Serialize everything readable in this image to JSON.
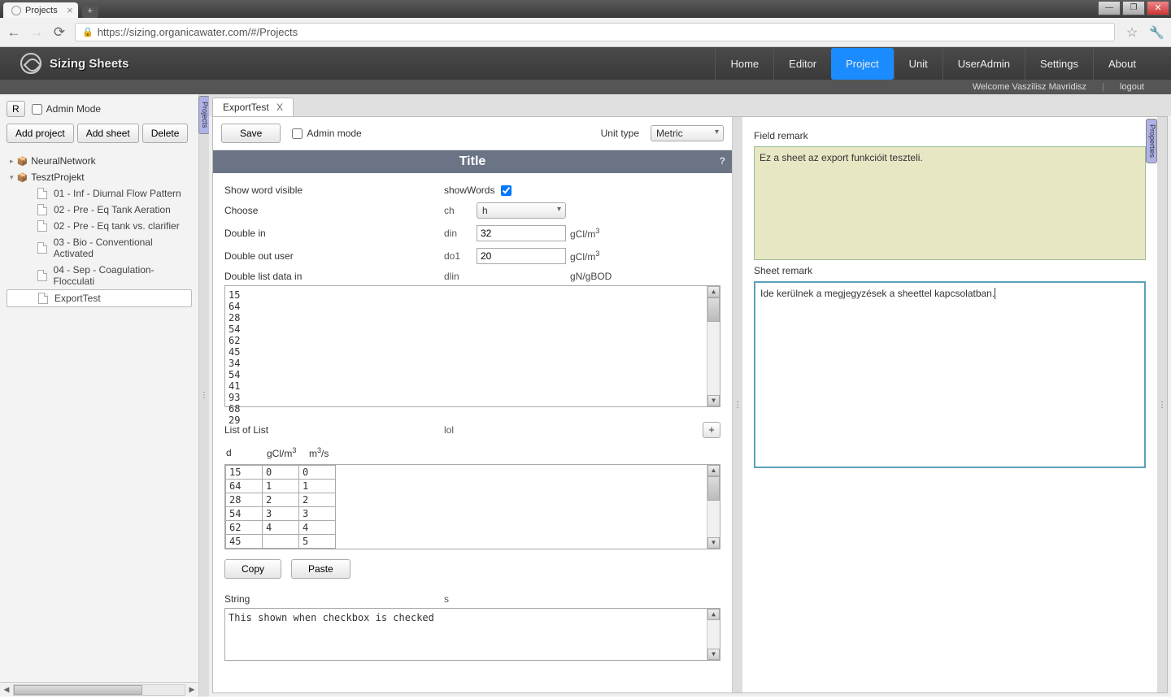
{
  "browser": {
    "tab_title": "Projects",
    "url": "https://sizing.organicawater.com/#/Projects"
  },
  "app": {
    "brand": "Sizing Sheets",
    "nav": [
      "Home",
      "Editor",
      "Project",
      "Unit",
      "UserAdmin",
      "Settings",
      "About"
    ],
    "nav_active_index": 2,
    "welcome": "Welcome Vaszilisz Mavridisz",
    "logout": "logout"
  },
  "sidebar": {
    "r_btn": "R",
    "admin_mode": "Admin Mode",
    "add_project": "Add project",
    "add_sheet": "Add sheet",
    "delete": "Delete",
    "gutter_label": "Projects",
    "projects": [
      {
        "name": "NeuralNetwork",
        "expanded": false
      },
      {
        "name": "TesztProjekt",
        "expanded": true,
        "sheets": [
          "01 - Inf - Diurnal Flow Pattern",
          "02 - Pre - Eq Tank Aeration",
          "02 - Pre - Eq tank vs. clarifier",
          "03 - Bio - Conventional Activated",
          "04 - Sep - Coagulation-Flocculati",
          "ExportTest"
        ],
        "selected_index": 5
      }
    ]
  },
  "doc": {
    "tab_label": "ExportTest",
    "save": "Save",
    "admin_mode": "Admin mode",
    "unit_type_label": "Unit type",
    "unit_type_value": "Metric",
    "title": "Title",
    "rows": {
      "show_word": {
        "label": "Show word visible",
        "code": "showWords",
        "checked": true
      },
      "choose": {
        "label": "Choose",
        "code": "ch",
        "value": "h"
      },
      "double_in": {
        "label": "Double in",
        "code": "din",
        "value": "32",
        "unit": "gCl/m³"
      },
      "double_out": {
        "label": "Double out user",
        "code": "do1",
        "value": "20",
        "unit": "gCl/m³"
      },
      "dlist": {
        "label": "Double list data in",
        "code": "dlin",
        "unit": "gN/gBOD",
        "data": "15\n64\n28\n54\n62\n45\n34\n54\n41\n93\n68\n29"
      },
      "lol": {
        "label": "List of List",
        "code": "lol",
        "headers": [
          "d",
          "gCl/m³",
          "m³/s"
        ],
        "rows": [
          [
            "15",
            "0",
            "0"
          ],
          [
            "64",
            "1",
            "1"
          ],
          [
            "28",
            "2",
            "2"
          ],
          [
            "54",
            "3",
            "3"
          ],
          [
            "62",
            "4",
            "4"
          ],
          [
            "45",
            "",
            "5"
          ]
        ]
      },
      "copy": "Copy",
      "paste": "Paste",
      "string": {
        "label": "String",
        "code": "s",
        "value": "This shown when checkbox is checked"
      }
    }
  },
  "remarks": {
    "field_label": "Field remark",
    "field_text": "Ez a sheet az export funkcióit teszteli.",
    "sheet_label": "Sheet remark",
    "sheet_text": "Ide kerülnek a megjegyzések a sheettel kapcsolatban.",
    "gutter_label": "Properties"
  }
}
